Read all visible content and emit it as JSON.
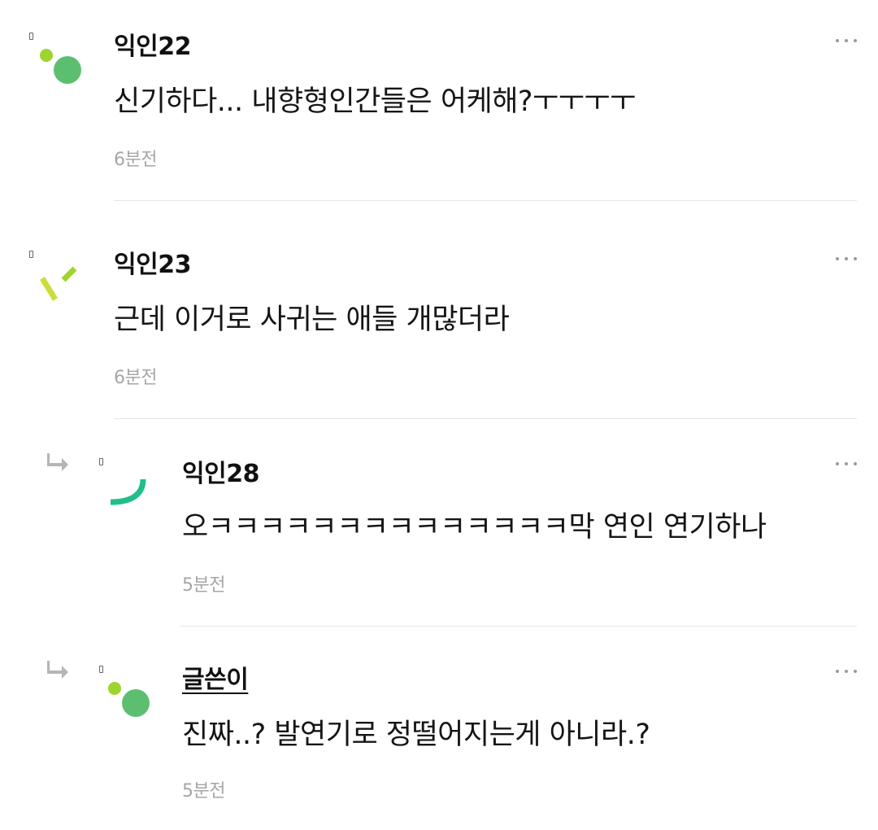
{
  "comments": [
    {
      "author": "익인22",
      "text": "신기하다... 내향형인간들은 어케해?ㅜㅜㅜㅜ",
      "time": "6분전",
      "avatar": "dot-and-circle-green"
    },
    {
      "author": "익인23",
      "text": "근데 이거로 사귀는 애들 개많더라",
      "time": "6분전",
      "avatar": "two-dashes-lime"
    },
    {
      "author": "익인28",
      "text": "오ㅋㅋㅋㅋㅋㅋㅋㅋㅋㅋㅋㅋㅋㅋ막 연인 연기하나",
      "time": "5분전",
      "avatar": "arc-teal",
      "is_reply": true
    },
    {
      "author": "글쓴이",
      "text": "진짜..? 발연기로 정떨어지는게 아니라.?",
      "time": "5분전",
      "avatar": "dot-and-circle-green",
      "is_reply": true,
      "is_op": true
    }
  ],
  "colors": {
    "avatar_green": "#5cbf70",
    "avatar_lime": "#9fd42f",
    "avatar_yellow": "#cddc39",
    "avatar_teal": "#1fbf8a",
    "time_gray": "#a6a6a6",
    "divider": "#e6e6e6"
  }
}
